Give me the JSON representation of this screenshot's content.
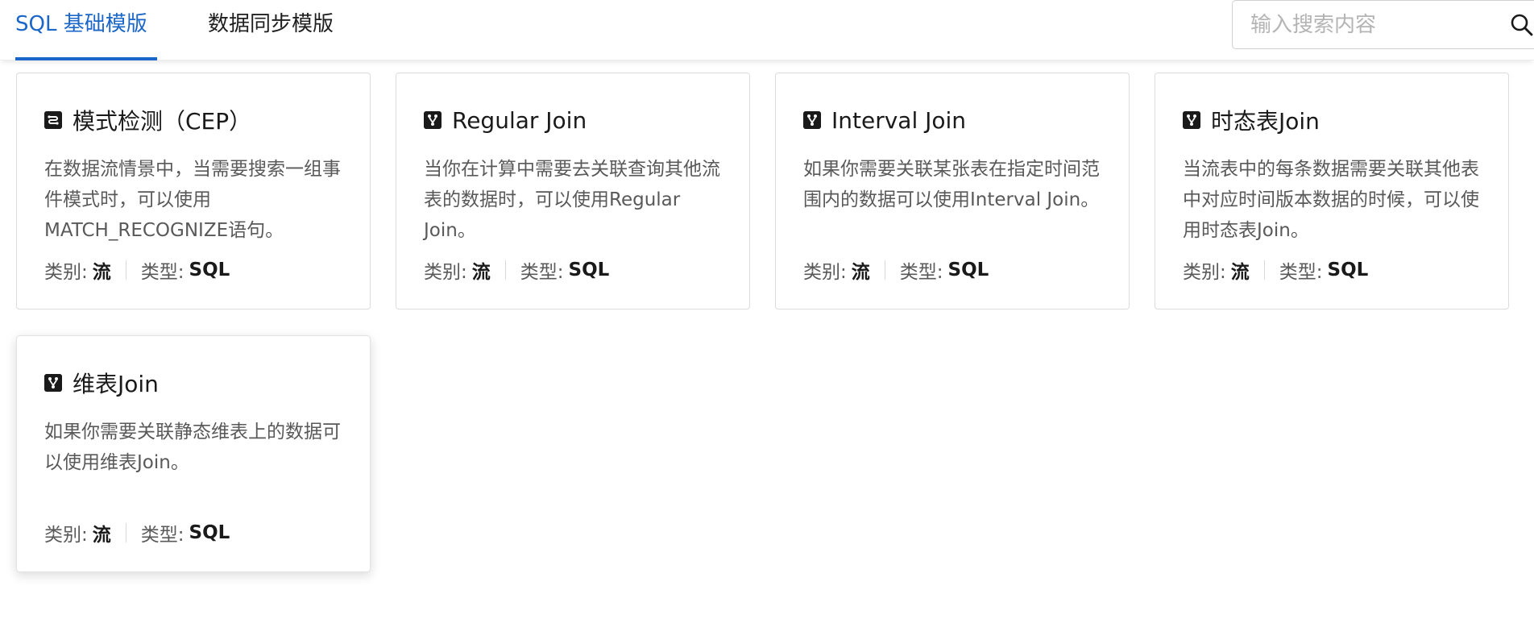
{
  "tabs": [
    {
      "label": "SQL 基础模版",
      "active": true
    },
    {
      "label": "数据同步模版",
      "active": false
    }
  ],
  "search": {
    "placeholder": "输入搜索内容",
    "icon": "search-icon"
  },
  "meta_labels": {
    "category": "类别:",
    "type": "类型:"
  },
  "colors": {
    "accent": "#1b66c9",
    "text": "#1a1a1a",
    "muted": "#595959"
  },
  "cards": [
    {
      "icon": "pattern-icon",
      "title": "模式检测（CEP）",
      "description": "在数据流情景中，当需要搜索一组事件模式时，可以使用MATCH_RECOGNIZE语句。",
      "category": "流",
      "type": "SQL"
    },
    {
      "icon": "join-icon",
      "title": "Regular Join",
      "description": "当你在计算中需要去关联查询其他流表的数据时，可以使用Regular Join。",
      "category": "流",
      "type": "SQL"
    },
    {
      "icon": "join-icon",
      "title": "Interval Join",
      "description": "如果你需要关联某张表在指定时间范围内的数据可以使用Interval Join。",
      "category": "流",
      "type": "SQL"
    },
    {
      "icon": "join-icon",
      "title": "时态表Join",
      "description": "当流表中的每条数据需要关联其他表中对应时间版本数据的时候，可以使用时态表Join。",
      "category": "流",
      "type": "SQL"
    },
    {
      "icon": "join-icon",
      "title": "维表Join",
      "description": "如果你需要关联静态维表上的数据可以使用维表Join。",
      "category": "流",
      "type": "SQL"
    }
  ]
}
